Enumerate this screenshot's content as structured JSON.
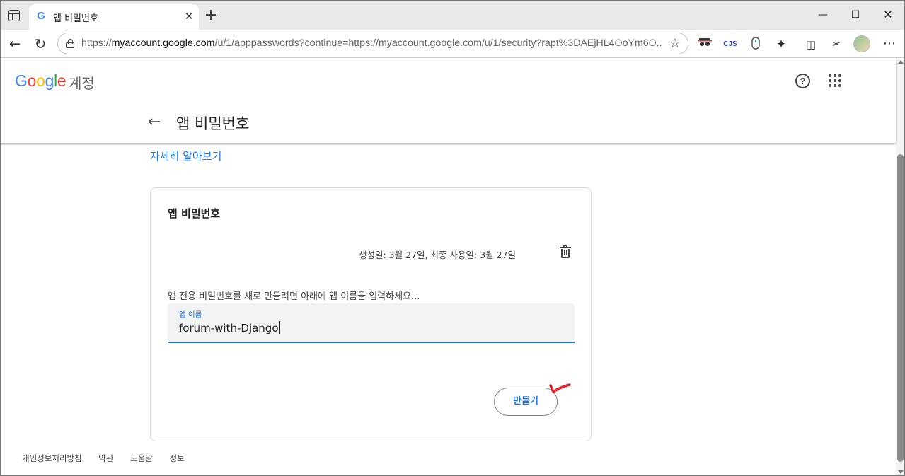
{
  "browser": {
    "tab_title": "앱 비밀번호",
    "tab_favicon": "G",
    "tab_close": "✕",
    "new_tab": "+",
    "url_scheme": "https://",
    "url_host": "myaccount.google.com",
    "url_rest": "/u/1/apppasswords?continue=https://myaccount.google.com/u/1/security?rapt%3DAEjHL4OoYm6O...",
    "extension_cjs_label": "CJS"
  },
  "header": {
    "logo": [
      "G",
      "o",
      "o",
      "g",
      "l",
      "e"
    ],
    "logo_suffix": "계정",
    "help_glyph": "?",
    "page_title": "앱 비밀번호"
  },
  "main": {
    "learn_more": "자세히 알아보기",
    "card": {
      "title": "앱 비밀번호",
      "password_meta": "생성일: 3월 27일, 최종 사용일: 3월 27일",
      "instruction": "앱 전용 비밀번호를 새로 만들려면 아래에 앱 이름을 입력하세요...",
      "field_label": "앱 이름",
      "field_value": "forum-with-Django",
      "create_button": "만들기"
    }
  },
  "footer": {
    "links": [
      "개인정보처리방침",
      "약관",
      "도움말",
      "정보"
    ]
  },
  "colors": {
    "accent": "#1a73e8",
    "annotation": "#e8202a"
  },
  "icons": [
    "window-icon",
    "google-favicon",
    "close-icon",
    "plus-icon",
    "minimize-icon",
    "maximize-icon",
    "back-icon",
    "reload-icon",
    "lock-icon",
    "star-icon",
    "puzzle-icon",
    "split-screen-icon",
    "help-icon",
    "apps-grid-icon",
    "arrow-left-icon",
    "trash-icon",
    "check-annotation-icon"
  ]
}
